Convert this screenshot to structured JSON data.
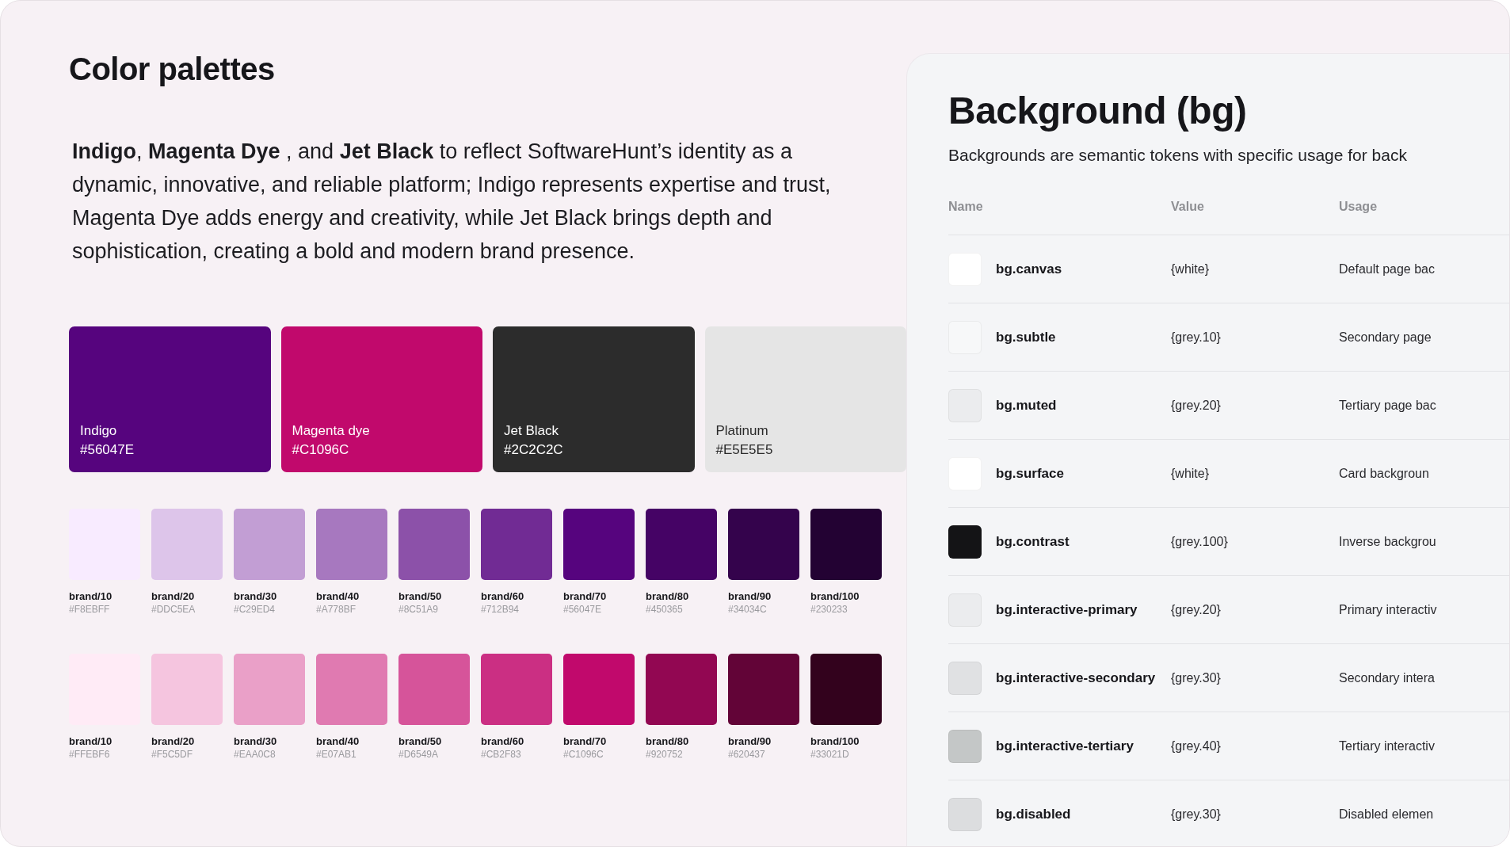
{
  "title": "Color palettes",
  "intro": "**Indigo**, **Magenta Dye** , and **Jet Black**  to reflect SoftwareHunt’s identity as a dynamic, innovative, and reliable platform; Indigo represents expertise and trust, Magenta Dye adds energy and creativity, while Jet Black brings depth and sophistication, creating a bold and modern brand presence.",
  "main_colors": [
    {
      "name": "Indigo",
      "hex": "#56047E",
      "color": "#56047e"
    },
    {
      "name": "Magenta dye",
      "hex": "#C1096C",
      "color": "#c1096c"
    },
    {
      "name": "Jet Black",
      "hex": "#2C2C2C",
      "color": "#2c2c2c"
    },
    {
      "name": "Platinum",
      "hex": "#E5E5E5",
      "color": "#e5e5e5"
    }
  ],
  "scales": [
    [
      {
        "name": "brand/10",
        "hex": "#F8EBFF",
        "color": "#f8ebff"
      },
      {
        "name": "brand/20",
        "hex": "#DDC5EA",
        "color": "#ddc5ea"
      },
      {
        "name": "brand/30",
        "hex": "#C29ED4",
        "color": "#c29ed4"
      },
      {
        "name": "brand/40",
        "hex": "#A778BF",
        "color": "#a778bf"
      },
      {
        "name": "brand/50",
        "hex": "#8C51A9",
        "color": "#8c51a9"
      },
      {
        "name": "brand/60",
        "hex": "#712B94",
        "color": "#712b94"
      },
      {
        "name": "brand/70",
        "hex": "#56047E",
        "color": "#56047e"
      },
      {
        "name": "brand/80",
        "hex": "#450365",
        "color": "#450365"
      },
      {
        "name": "brand/90",
        "hex": "#34034C",
        "color": "#34034c"
      },
      {
        "name": "brand/100",
        "hex": "#230233",
        "color": "#230233"
      }
    ],
    [
      {
        "name": "brand/10",
        "hex": "#FFEBF6",
        "color": "#ffebf6"
      },
      {
        "name": "brand/20",
        "hex": "#F5C5DF",
        "color": "#f5c5df"
      },
      {
        "name": "brand/30",
        "hex": "#EAA0C8",
        "color": "#eaa0c8"
      },
      {
        "name": "brand/40",
        "hex": "#E07AB1",
        "color": "#e07ab1"
      },
      {
        "name": "brand/50",
        "hex": "#D6549A",
        "color": "#d6549a"
      },
      {
        "name": "brand/60",
        "hex": "#CB2F83",
        "color": "#cb2f83"
      },
      {
        "name": "brand/70",
        "hex": "#C1096C",
        "color": "#c1096c"
      },
      {
        "name": "brand/80",
        "hex": "#920752",
        "color": "#920752"
      },
      {
        "name": "brand/90",
        "hex": "#620437",
        "color": "#620437"
      },
      {
        "name": "brand/100",
        "hex": "#33021D",
        "color": "#33021d"
      }
    ]
  ],
  "panel": {
    "title": "Background (bg)",
    "subtitle": "Backgrounds are semantic tokens with specific usage for back",
    "columns": [
      "Name",
      "Value",
      "Usage"
    ],
    "rows": [
      {
        "name": "bg.canvas",
        "value": "{white}",
        "usage": "Default page bac",
        "color": "#ffffff"
      },
      {
        "name": "bg.subtle",
        "value": "{grey.10}",
        "usage": "Secondary page",
        "color": "#f7f8f9"
      },
      {
        "name": "bg.muted",
        "value": "{grey.20}",
        "usage": "Tertiary page bac",
        "color": "#ebecee"
      },
      {
        "name": "bg.surface",
        "value": "{white}",
        "usage": "Card backgroun",
        "color": "#ffffff"
      },
      {
        "name": "bg.contrast",
        "value": "{grey.100}",
        "usage": "Inverse backgrou",
        "color": "#141416"
      },
      {
        "name": "bg.interactive-primary",
        "value": "{grey.20}",
        "usage": "Primary interactiv",
        "color": "#ebecee"
      },
      {
        "name": "bg.interactive-secondary",
        "value": "{grey.30}",
        "usage": "Secondary intera",
        "color": "#e0e1e3"
      },
      {
        "name": "bg.interactive-tertiary",
        "value": "{grey.40}",
        "usage": "Tertiary interactiv",
        "color": "#c4c7c7"
      },
      {
        "name": "bg.disabled",
        "value": "{grey.30}",
        "usage": "Disabled elemen",
        "color": "#dcdddf"
      }
    ]
  }
}
